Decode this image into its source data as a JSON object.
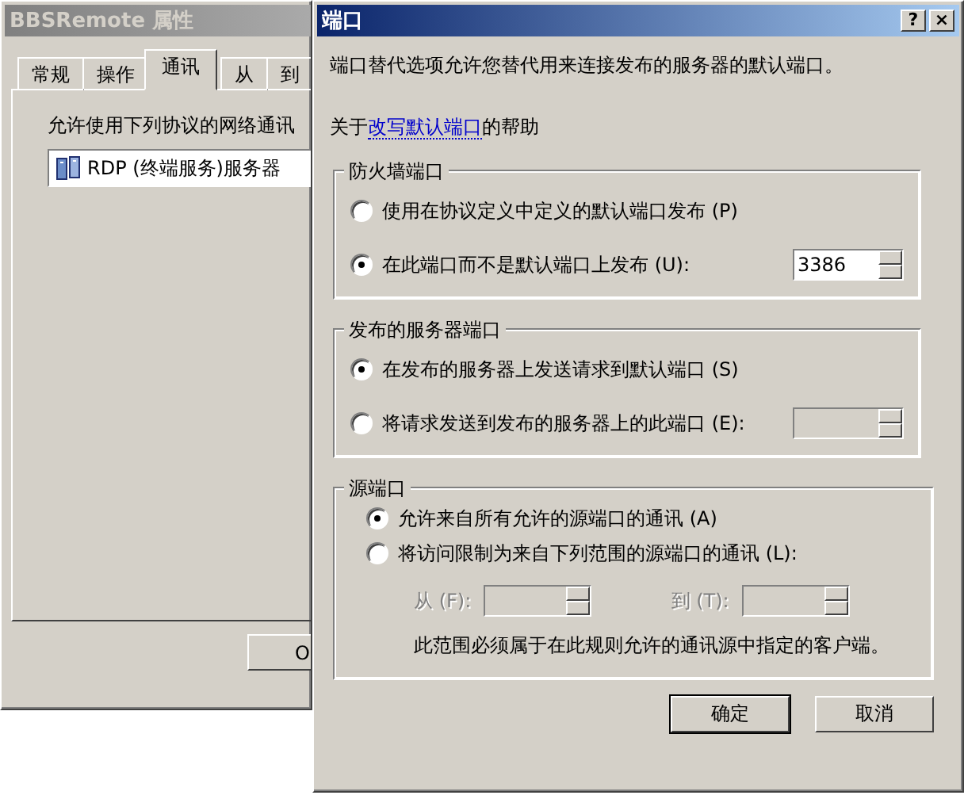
{
  "back_window": {
    "title": "BBSRemote 属性",
    "tabs": [
      {
        "label": "常规",
        "selected": false
      },
      {
        "label": "操作",
        "selected": false
      },
      {
        "label": "通讯",
        "selected": true
      },
      {
        "label": "从",
        "selected": false
      },
      {
        "label": "到",
        "selected": false
      }
    ],
    "prompt": "允许使用下列协议的网络通讯",
    "list_items": [
      {
        "label": "RDP (终端服务)服务器"
      }
    ],
    "buttons": [
      "O"
    ]
  },
  "dialog": {
    "title": "端口",
    "title_buttons": [
      "?",
      "×"
    ],
    "description": "端口替代选项允许您替代用来连接发布的服务器的默认端口。",
    "help": {
      "prefix": "关于",
      "link": "改写默认端口",
      "suffix": "的帮助"
    },
    "groups": [
      {
        "title": "防火墙端口",
        "rows": [
          {
            "kind": "radio",
            "label": "使用在协议定义中定义的默认端口发布 (P)",
            "selected": false
          },
          {
            "kind": "radio_spin",
            "label": "在此端口而不是默认端口上发布 (U):",
            "selected": true,
            "spin": {
              "value": "3386",
              "disabled": false
            }
          }
        ]
      },
      {
        "title": "发布的服务器端口",
        "rows": [
          {
            "kind": "radio",
            "label": "在发布的服务器上发送请求到默认端口 (S)",
            "selected": true
          },
          {
            "kind": "radio_spin",
            "label": "将请求发送到发布的服务器上的此端口 (E):",
            "selected": false,
            "spin": {
              "disabled": true
            }
          }
        ]
      },
      {
        "title": "源端口",
        "rows": [
          {
            "kind": "radio",
            "label": "允许来自所有允许的源端口的通讯 (A)",
            "selected": true
          },
          {
            "kind": "radio",
            "label": "将访问限制为来自下列范围的源端口的通讯 (L):",
            "selected": false
          },
          {
            "kind": "range",
            "from_label": "从 (F):",
            "to_label": "到 (T):",
            "disabled": true
          },
          {
            "kind": "note",
            "text": "此范围必须属于在此规则允许的通讯源中指定的客户端。"
          }
        ]
      }
    ],
    "buttons": [
      {
        "label": "确定",
        "default": true
      },
      {
        "label": "取消",
        "default": false
      }
    ]
  }
}
